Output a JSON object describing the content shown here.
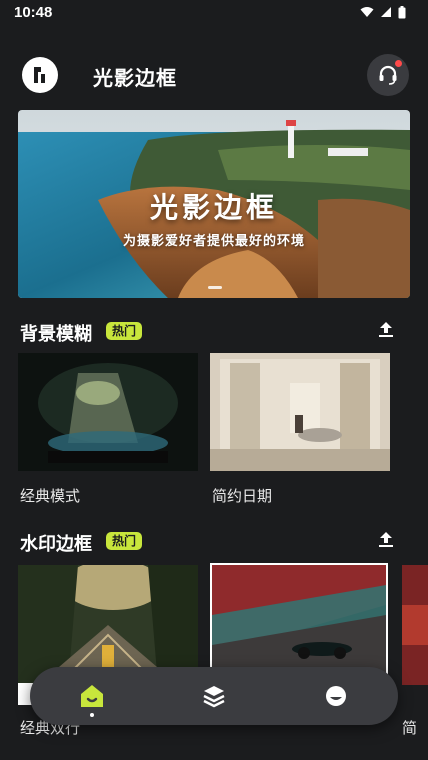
{
  "status_bar": {
    "time": "10:48"
  },
  "header": {
    "app_title": "光影边框"
  },
  "banner": {
    "title": "光影边框",
    "subtitle": "为摄影爱好者提供最好的环境"
  },
  "sections": [
    {
      "title": "背景模糊",
      "badge": "热门",
      "cards": [
        {
          "label": "经典模式"
        },
        {
          "label": "简约日期"
        }
      ]
    },
    {
      "title": "水印边框",
      "badge": "热门",
      "cards": [
        {
          "label": "经典双行"
        },
        {
          "label": ""
        },
        {
          "label": "简"
        }
      ]
    }
  ],
  "bottom_nav": {
    "items": [
      {
        "icon": "home-icon",
        "active": true
      },
      {
        "icon": "layers-icon",
        "active": false
      },
      {
        "icon": "profile-icon",
        "active": false
      }
    ]
  },
  "colors": {
    "background": "#1b1c1e",
    "accent": "#c8e63c",
    "nav_bg": "#3b3c40",
    "notification": "#ff4a4a"
  }
}
